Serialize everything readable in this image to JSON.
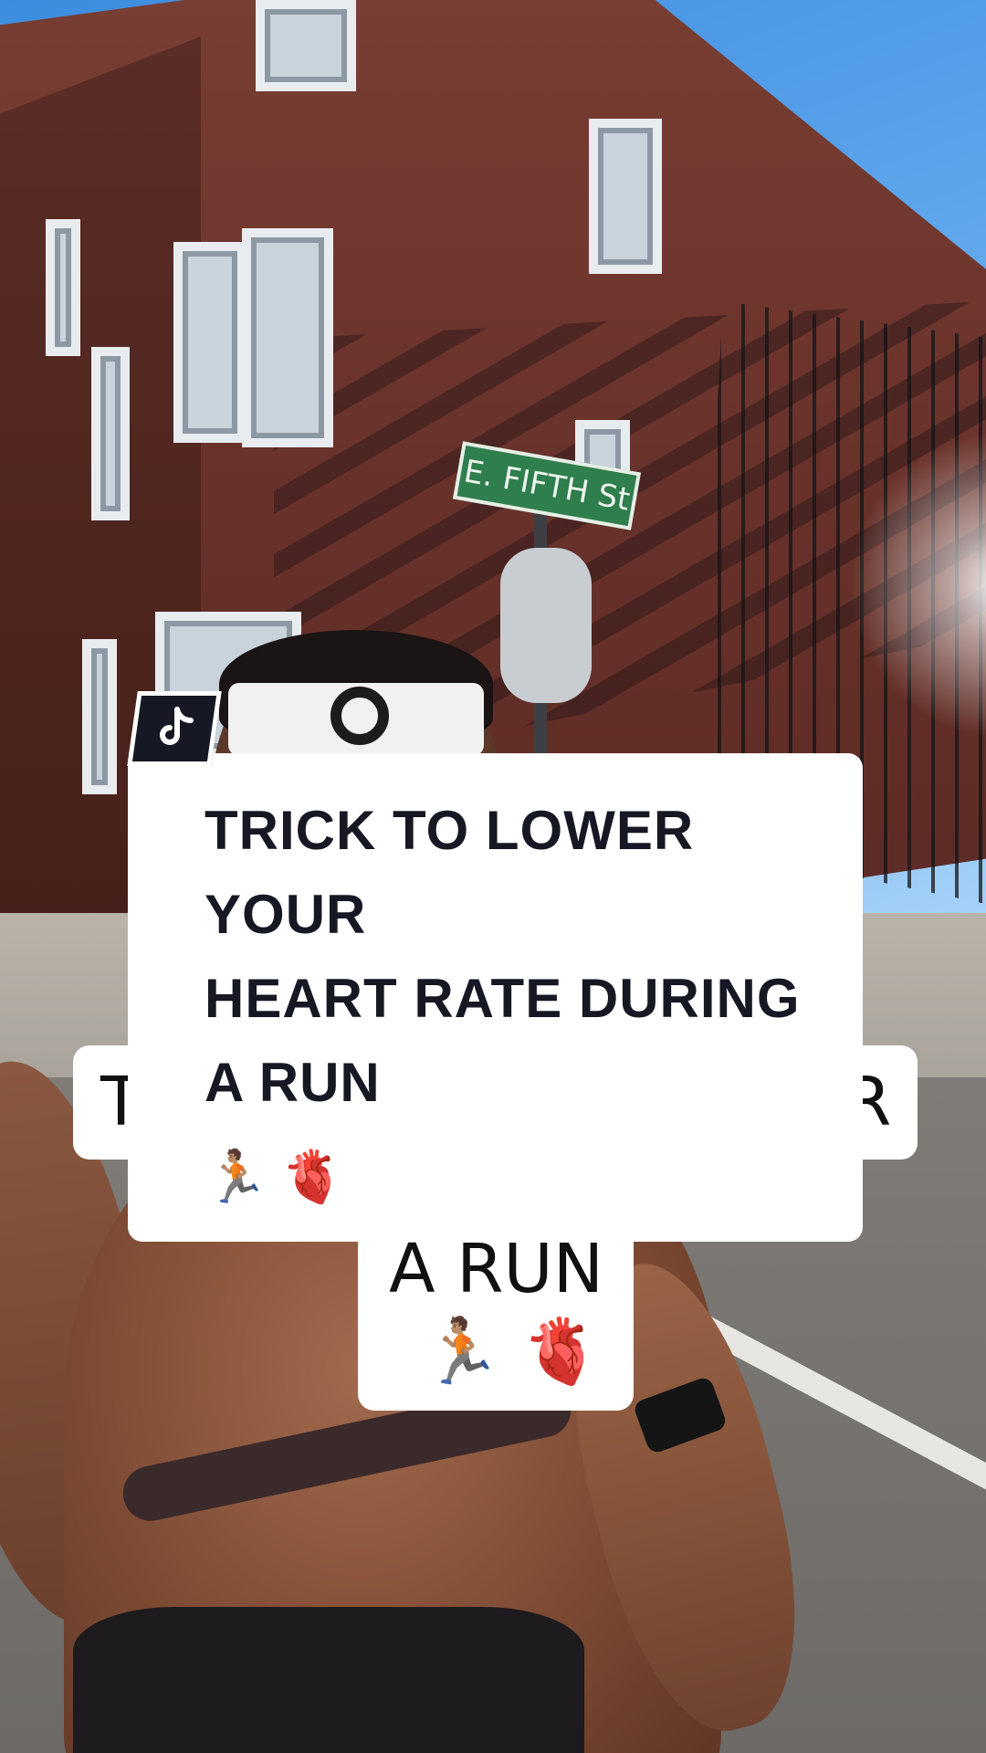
{
  "background": {
    "street_sign": "E. FIFTH St"
  },
  "caption": {
    "lines": [
      "TRICK TO LOWER",
      "YOUR",
      "HEART RATE DURING",
      "A RUN"
    ],
    "emoji": {
      "runner": "🏃🏽",
      "heart": "🫀"
    }
  },
  "ghost_caption": {
    "left_fragment": "T",
    "right_fragment": "R",
    "run_line": "A RUN",
    "emoji": "🏃🏽 🫀"
  },
  "badge": {
    "icon": "tiktok-logo-icon"
  },
  "colors": {
    "caption_text": "#161823",
    "card_bg": "#ffffff",
    "badge_bg": "#161823"
  }
}
